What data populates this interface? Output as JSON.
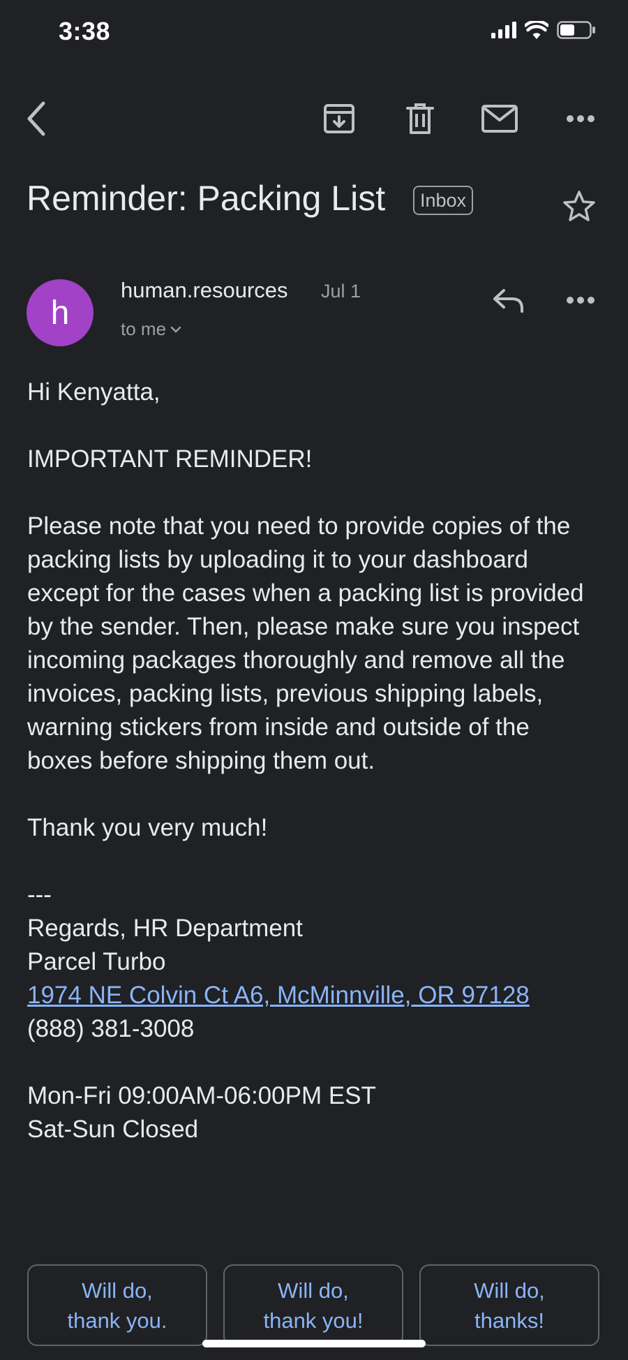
{
  "status_bar": {
    "time": "3:38"
  },
  "toolbar": {
    "back_icon": "chevron-left-icon",
    "archive_icon": "archive-icon",
    "delete_icon": "trash-icon",
    "mark_unread_icon": "mail-icon",
    "more_icon": "more-horizontal-icon"
  },
  "email": {
    "subject": "Reminder: Packing List",
    "label": "Inbox",
    "sender": {
      "avatar_letter": "h",
      "avatar_color": "#a142c7",
      "name": "human.resources",
      "date": "Jul 1",
      "recipient": "to me"
    },
    "body": {
      "greeting": "Hi Kenyatta,",
      "headline": "IMPORTANT REMINDER!",
      "paragraph": "Please note that you need to provide copies of the packing lists by uploading it to your dashboard except for the cases when a packing list is provided by the sender. Then, please make sure you inspect incoming packages thoroughly and remove all the invoices, packing lists, previous shipping labels, warning stickers from inside and outside of the boxes before shipping them out.",
      "thanks": "Thank you very much!",
      "separator": "---",
      "regards": "Regards, HR Department",
      "company": "Parcel Turbo",
      "address": "1974 NE Colvin Ct A6, McMinnville, OR 97128",
      "phone": "(888) 381-3008",
      "hours_weekday": "Mon-Fri 09:00AM-06:00PM EST",
      "hours_weekend": "Sat-Sun Closed"
    }
  },
  "smart_replies": [
    "Will do,\nthank you.",
    "Will do,\nthank you!",
    "Will do,\nthanks!"
  ],
  "colors": {
    "background": "#202124",
    "link": "#8ab4f8",
    "avatar": "#a142c7"
  }
}
